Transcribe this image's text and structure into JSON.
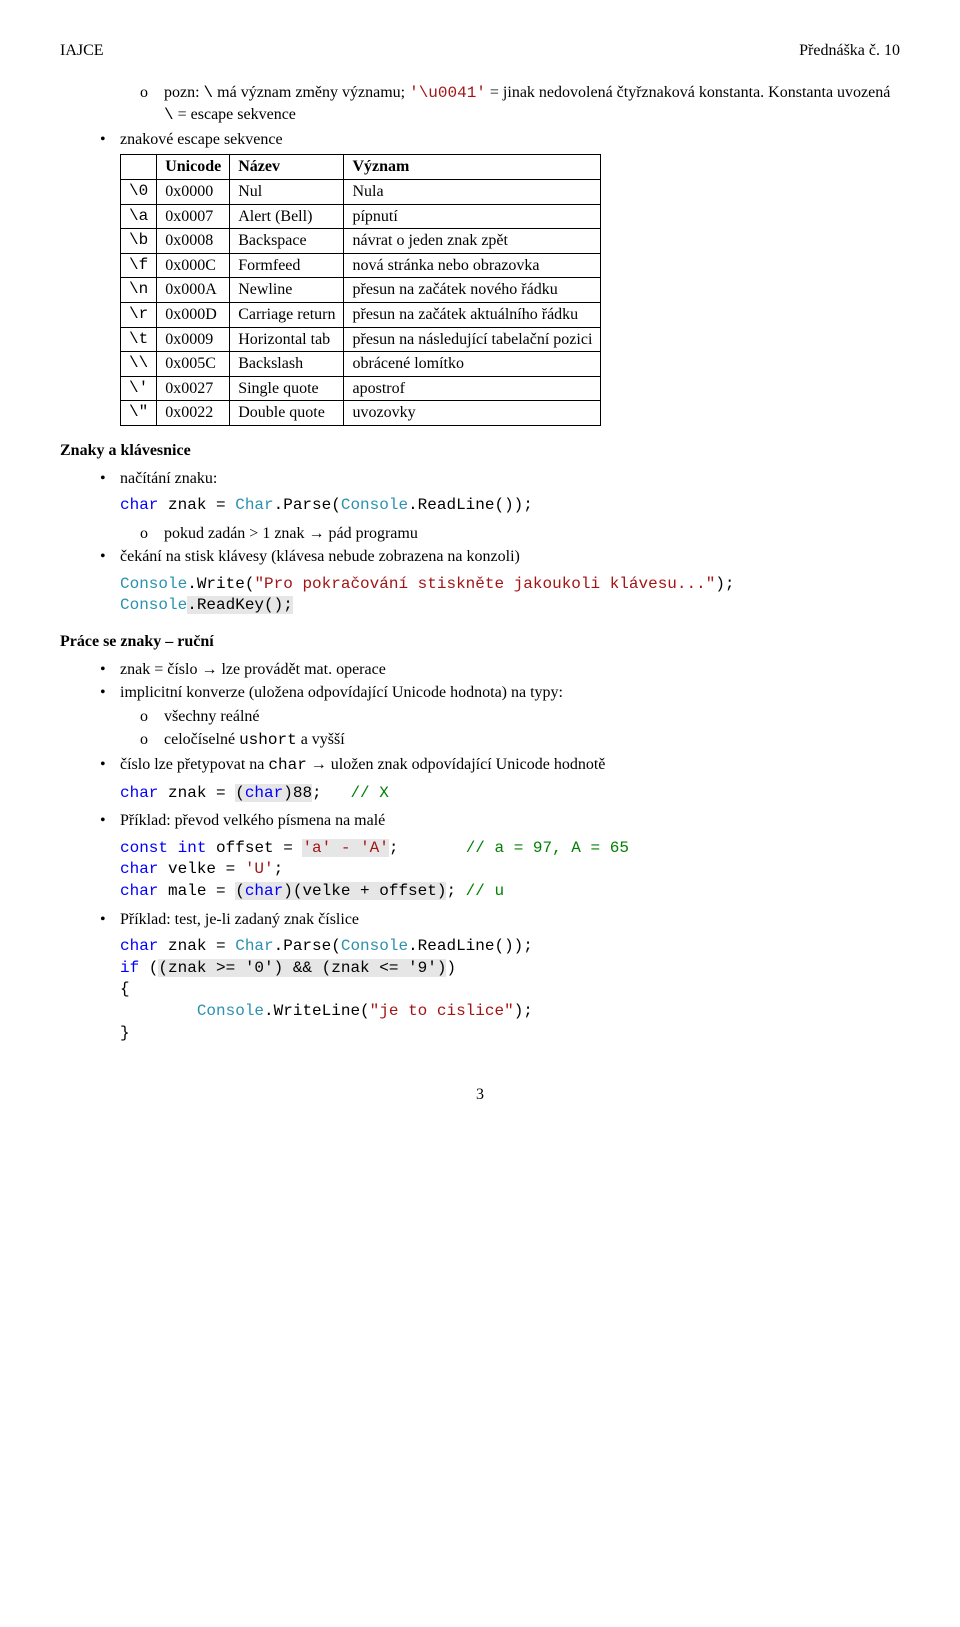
{
  "header": {
    "left": "IAJCE",
    "right": "Přednáška č. 10"
  },
  "intro": {
    "line1_a": "pozn: ",
    "line1_mono1": "\\",
    "line1_b": " má význam změny významu; ",
    "line1_mono2": "'\\u0041'",
    "line1_c": " = jinak nedovolená čtyřznaková konstanta.",
    "line2_a": "Konstanta uvozená ",
    "line2_mono": "\\",
    "line2_b": " = escape sekvence"
  },
  "table_title": "znakové escape sekvence",
  "table": {
    "headers": [
      "",
      "Unicode",
      "Název",
      "Význam"
    ],
    "rows": [
      {
        "c0": "\\0",
        "c1": "0x0000",
        "c2": "Nul",
        "c3": "Nula"
      },
      {
        "c0": "\\a",
        "c1": "0x0007",
        "c2": "Alert (Bell)",
        "c3": "pípnutí"
      },
      {
        "c0": "\\b",
        "c1": "0x0008",
        "c2": "Backspace",
        "c3": "návrat o jeden znak zpět"
      },
      {
        "c0": "\\f",
        "c1": "0x000C",
        "c2": "Formfeed",
        "c3": "nová stránka nebo obrazovka"
      },
      {
        "c0": "\\n",
        "c1": "0x000A",
        "c2": "Newline",
        "c3": "přesun na začátek nového řádku"
      },
      {
        "c0": "\\r",
        "c1": "0x000D",
        "c2": "Carriage return",
        "c3": "přesun na začátek aktuálního řádku"
      },
      {
        "c0": "\\t",
        "c1": "0x0009",
        "c2": "Horizontal tab",
        "c3": "přesun na následující tabelační pozici"
      },
      {
        "c0": "\\\\",
        "c1": "0x005C",
        "c2": "Backslash",
        "c3": "obrácené lomítko"
      },
      {
        "c0": "\\'",
        "c1": "0x0027",
        "c2": "Single quote",
        "c3": "apostrof"
      },
      {
        "c0": "\\\"",
        "c1": "0x0022",
        "c2": "Double quote",
        "c3": "uvozovky"
      }
    ]
  },
  "sec1": {
    "title": "Znaky a klávesnice",
    "b1": "načítání znaku:",
    "code1": {
      "kw": "char",
      "rest1": " znak = ",
      "cls": "Char",
      "rest2": ".Parse(",
      "cls2": "Console",
      "rest3": ".ReadLine());"
    },
    "sub1": "pokud zadán > 1 znak → pád programu",
    "b2": "čekání na stisk klávesy (klávesa nebude zobrazena na konzoli)",
    "code2a": {
      "cls": "Console",
      "rest1": ".Write(",
      "str": "\"Pro pokračování stiskněte jakoukoli klávesu...\"",
      "rest2": ");"
    },
    "code2b": {
      "cls": "Console",
      "bg": ".ReadKey();"
    }
  },
  "sec2": {
    "title": "Práce se znaky – ruční",
    "b1": "znak = číslo → lze provádět mat. operace",
    "b2": "implicitní konverze (uložena odpovídající Unicode hodnota) na typy:",
    "b2s1": "všechny reálné",
    "b2s2_a": "celočíselné ",
    "b2s2_mono": "ushort",
    "b2s2_b": " a vyšší",
    "b3_a": "číslo lze přetypovat na ",
    "b3_mono": "char",
    "b3_b": " → uložen znak odpovídající Unicode hodnotě",
    "code3": {
      "kw": "char",
      "rest1": " znak = ",
      "bg": "(",
      "kw2": "char",
      "bg2": ")88",
      "rest2": ";   ",
      "cmt": "// X"
    },
    "b4": "Příklad: převod velkého písmena na malé",
    "code4a": {
      "kw": "const",
      "kw2": "int",
      "rest1": " offset = ",
      "bg": "'a' - 'A'",
      "rest2": ";       ",
      "cmt": "// a = 97, A = 65"
    },
    "code4b": {
      "kw": "char",
      "rest1": " velke = ",
      "str": "'U'",
      "rest2": ";"
    },
    "code4c": {
      "kw": "char",
      "rest1": " male = ",
      "bg_a": "(",
      "kw2": "char",
      "bg_b": ")(velke + offset)",
      "rest2": "; ",
      "cmt": "// u"
    },
    "b5": "Příklad: test, je-li zadaný znak číslice",
    "code5a": {
      "kw": "char",
      "rest1": " znak = ",
      "cls": "Char",
      "rest2": ".Parse(",
      "cls2": "Console",
      "rest3": ".ReadLine());"
    },
    "code5b": {
      "kw": "if",
      "rest1": " (",
      "bg": "(znak >= '0') && (znak <= '9')",
      "rest2": ")"
    },
    "code5c": "{",
    "code5d": {
      "sp": "        ",
      "cls": "Console",
      "rest1": ".WriteLine(",
      "str": "\"je to cislice\"",
      "rest2": ");"
    },
    "code5e": "}"
  },
  "page": "3"
}
